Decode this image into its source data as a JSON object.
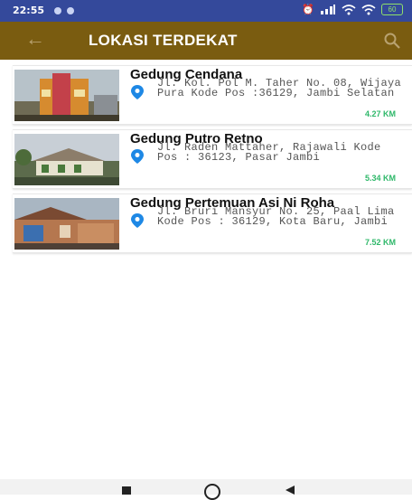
{
  "status_bar": {
    "time": "22:55",
    "battery": "60"
  },
  "app_bar": {
    "title": "LOKASI TERDEKAT",
    "icons": [
      "back-arrow-icon",
      "search-icon"
    ]
  },
  "colors": {
    "status_bar": "#34499b",
    "app_bar": "#7a5c10",
    "distance": "#2fb86a",
    "pin": "#1e88e5"
  },
  "locations": [
    {
      "name": "Gedung Cendana",
      "address": "Jl. Kol. Pol M. Taher No. 08, Wijaya Pura Kode Pos :36129, Jambi Selatan",
      "distance": "4.27 KM"
    },
    {
      "name": "Gedung Putro Retno",
      "address": "Jl. Raden Mattaher, Rajawali Kode Pos : 36123, Pasar Jambi",
      "distance": "5.34 KM"
    },
    {
      "name": "Gedung Pertemuan Asi Ni Roha",
      "address": "Jl. Bruri Mansyur No. 25, Paal Lima Kode Pos : 36129, Kota Baru, Jambi",
      "distance": "7.52 KM"
    }
  ]
}
